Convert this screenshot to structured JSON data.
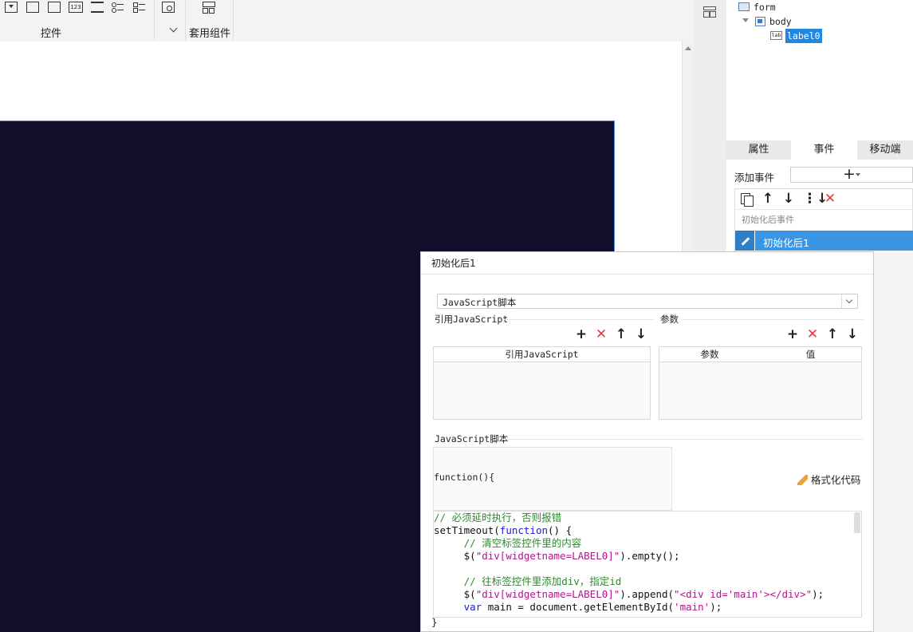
{
  "toolbar": {
    "controls_group_label": "控件",
    "components_group_label": "套用组件"
  },
  "tree": {
    "items": [
      {
        "label": "form"
      },
      {
        "label": "body"
      },
      {
        "label": "label0"
      }
    ]
  },
  "panel_tabs": [
    {
      "label": "属性"
    },
    {
      "label": "事件"
    },
    {
      "label": "移动端"
    }
  ],
  "events": {
    "add_event_label": "添加事件",
    "add_button": "+",
    "group_label": "初始化后事件",
    "selected_event": "初始化后1"
  },
  "dialog": {
    "title": "初始化后1",
    "type_select": "JavaScript脚本",
    "ref_js_section": "引用JavaScript",
    "params_section": "参数",
    "ref_js_column": "引用JavaScript",
    "param_column": "参数",
    "value_column": "值",
    "script_section": "JavaScript脚本",
    "function_header": "function(){",
    "format_code_label": "格式化代码",
    "closing_brace": "}",
    "code_lines": [
      "// 必须延时执行，否则报错",
      "setTimeout(function() {",
      "     // 清空标签控件里的内容",
      "     $(\"div[widgetname=LABEL0]\").empty();",
      "",
      "     // 往标签控件里添加div，指定id",
      "     $(\"div[widgetname=LABEL0]\").append(\"<div id='main'></div>\");",
      "     var main = document.getElementById('main');"
    ]
  }
}
